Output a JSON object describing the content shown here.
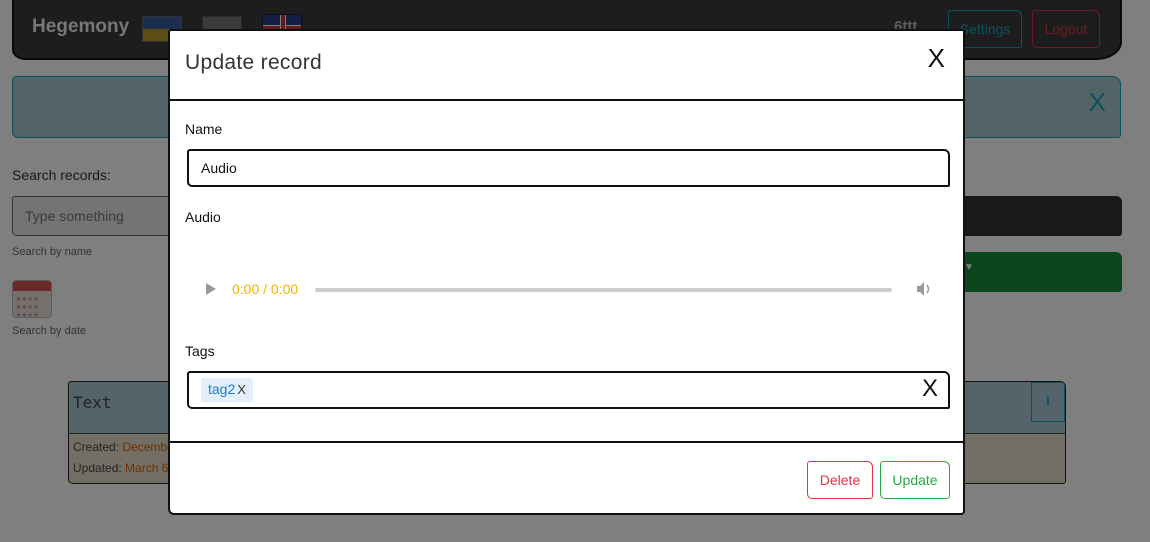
{
  "navbar": {
    "brand": "Hegemony",
    "user": "6ttt",
    "settings_label": "Settings",
    "logout_label": "Logout"
  },
  "alert": {
    "close": "X",
    "color": "#17a2b8"
  },
  "search": {
    "label": "Search records:",
    "placeholder": "Type something",
    "help_name": "Search by name",
    "help_date": "Search by date"
  },
  "record_card": {
    "title": "Text",
    "created_label": "Created:",
    "created_value": "December",
    "updated_label": "Updated:",
    "updated_value": "March 6",
    "info_label": "i"
  },
  "modal": {
    "title": "Update record",
    "close": "X",
    "name_label": "Name",
    "name_value": "Audio",
    "audio_label": "Audio",
    "audio_time": "0:00 / 0:00",
    "tags_label": "Tags",
    "tags": [
      {
        "label": "tag2",
        "remove": "X"
      }
    ],
    "tags_clear": "X",
    "delete_label": "Delete",
    "update_label": "Update"
  },
  "colors": {
    "danger": "#dc3545",
    "success": "#28a745",
    "info": "#17a2b8",
    "audio_time": "#f0b400"
  }
}
